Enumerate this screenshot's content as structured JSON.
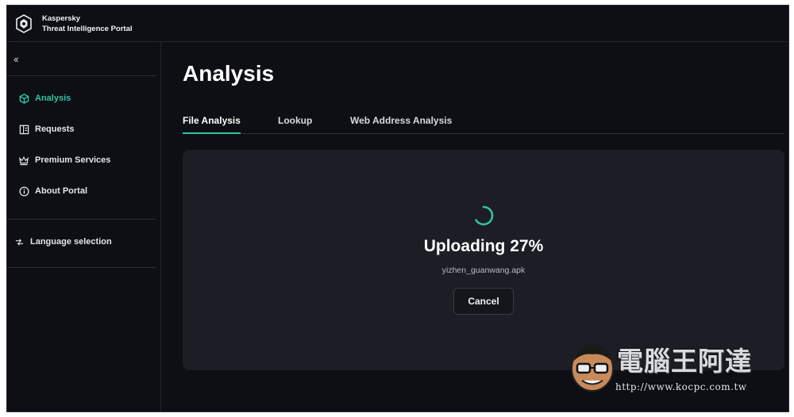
{
  "brand": {
    "name": "Kaspersky",
    "product": "Threat Intelligence Portal"
  },
  "sidebar": {
    "collapse_icon": "double-chevron-left-icon",
    "items": [
      {
        "label": "Analysis",
        "icon": "cube-icon",
        "active": true
      },
      {
        "label": "Requests",
        "icon": "requests-icon",
        "active": false
      },
      {
        "label": "Premium Services",
        "icon": "crown-icon",
        "active": false
      },
      {
        "label": "About Portal",
        "icon": "info-icon",
        "active": false
      }
    ],
    "language": {
      "label": "Language selection",
      "icon": "language-icon"
    }
  },
  "main": {
    "title": "Analysis",
    "tabs": [
      {
        "label": "File Analysis",
        "active": true
      },
      {
        "label": "Lookup",
        "active": false
      },
      {
        "label": "Web Address Analysis",
        "active": false
      }
    ],
    "upload": {
      "status": "Uploading 27%",
      "progress_percent": 27,
      "filename": "yizhen_guanwang.apk",
      "cancel_label": "Cancel"
    }
  },
  "watermark": {
    "title": "電腦王阿達",
    "url": "http://www.kocpc.com.tw"
  },
  "colors": {
    "accent": "#2fc3a4",
    "background": "#0e0f15",
    "panel": "#1c1d25"
  }
}
